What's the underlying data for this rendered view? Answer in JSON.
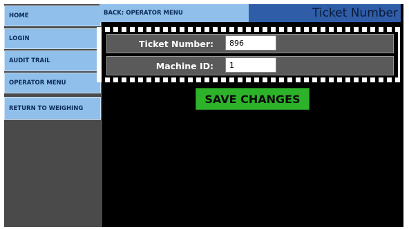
{
  "sidebar": {
    "items": [
      {
        "label": "HOME"
      },
      {
        "label": "LOGIN"
      },
      {
        "label": "AUDIT TRAIL"
      },
      {
        "label": "OPERATOR MENU"
      },
      {
        "label": "RETURN TO WEIGHING"
      }
    ]
  },
  "header": {
    "back_label": "BACK: OPERATOR MENU",
    "title": "Ticket Number"
  },
  "form": {
    "ticket_label": "Ticket Number:",
    "ticket_value": "896",
    "machine_label": "Machine ID:",
    "machine_value": "1"
  },
  "actions": {
    "save_label": "SAVE CHANGES"
  },
  "colors": {
    "nav_button": "#8fbfea",
    "title_bar": "#2f5da8",
    "save_button": "#2db32a",
    "background": "#000000"
  }
}
